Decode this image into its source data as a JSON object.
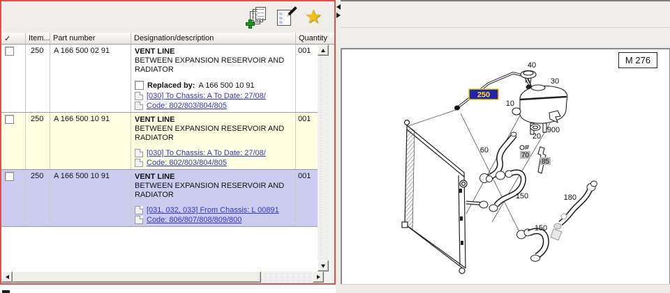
{
  "left_panel": {
    "toolbar": {
      "icons": [
        {
          "name": "add-document-stack"
        },
        {
          "name": "edit-notes"
        },
        {
          "name": "favorites-star",
          "glyph": "★"
        }
      ]
    },
    "table": {
      "header": {
        "check": "✓",
        "item": "Item...",
        "part_number": "Part number",
        "designation": "Designation/description",
        "quantity": "Quantity"
      },
      "rows": [
        {
          "item": "250",
          "part_number": "A 166 500 02 91",
          "name": "VENT LINE",
          "description": "BETWEEN EXPANSION RESERVOIR AND RADIATOR",
          "replaced_by_label": "Replaced by:",
          "replaced_by_value": "A 166 500 10 91",
          "links": [
            {
              "text": "[030] To Chassis: A To Date: 27/08/"
            },
            {
              "text": "Code: 802/803/804/805"
            }
          ],
          "quantity": "001"
        },
        {
          "item": "250",
          "part_number": "A 166 500 10 91",
          "name": "VENT LINE",
          "description": "BETWEEN EXPANSION RESERVOIR AND RADIATOR",
          "links": [
            {
              "text": "[030] To Chassis: A To Date: 27/08/"
            },
            {
              "text": "Code: 802/803/804/805"
            }
          ],
          "quantity": "001"
        },
        {
          "item": "250",
          "part_number": "A 166 500 10 91",
          "name": "VENT LINE",
          "description": "BETWEEN EXPANSION RESERVOIR AND RADIATOR",
          "links": [
            {
              "text": "[031, 032, 033] From Chassis: L 00891"
            },
            {
              "text": "Code: 806/807/808/809/800"
            }
          ],
          "quantity": "001"
        }
      ]
    }
  },
  "right_panel": {
    "engine_code": "M 276",
    "diagram": {
      "selected_callout": "250",
      "labels": {
        "reservoir": "10",
        "grommet": "20",
        "cap_small": "30",
        "cap": "40",
        "hose_vent": "60",
        "screw": "70",
        "bracket": "85",
        "hose_upper": "150",
        "hose_lower": "150",
        "hose_engine": "180",
        "marker": "900"
      }
    }
  },
  "colors": {
    "panel_border": "#e0514d",
    "selected_row": "#ccccf0",
    "alt_row": "#ffffe1",
    "link": "#3333cc",
    "callout_bg": "#2222aa",
    "callout_text": "#ffe11a",
    "label_box_bg": "#b9b9b9"
  }
}
